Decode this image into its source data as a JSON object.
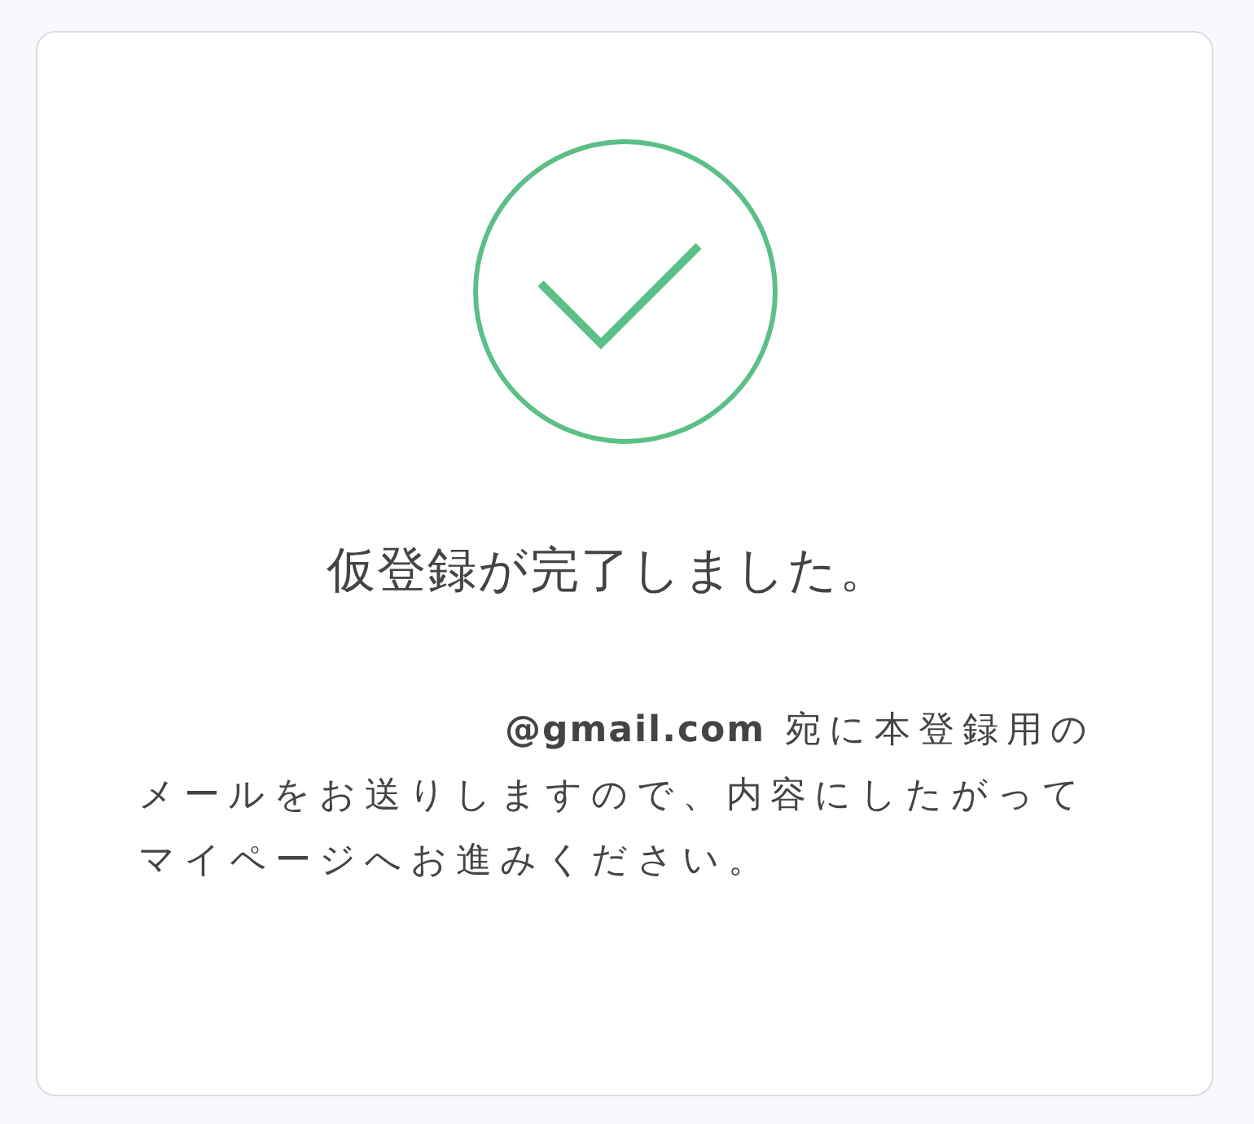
{
  "status": {
    "kind": "success"
  },
  "title": "仮登録が完了しました。",
  "message": "**@gmail.com** 宛に本登録用のメールをお送りしますので、内容にしたがってマイページへお進みください。"
}
